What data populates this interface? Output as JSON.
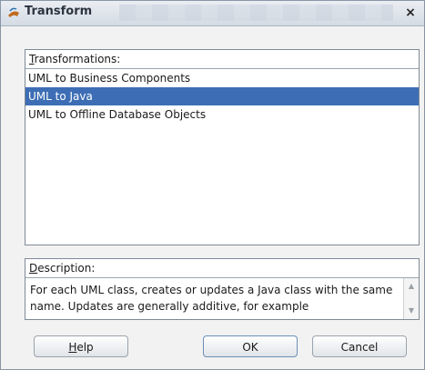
{
  "window": {
    "title": "Transform",
    "close_label": "×"
  },
  "transformations": {
    "label_mnemonic": "T",
    "label_rest": "ransformations:",
    "items": [
      {
        "label": "UML to Business Components",
        "selected": false
      },
      {
        "label": "UML to Java",
        "selected": true
      },
      {
        "label": "UML to Offline Database Objects",
        "selected": false
      }
    ]
  },
  "description": {
    "label_mnemonic": "D",
    "label_rest": "escription:",
    "text": "For each UML class, creates or updates a Java class with the same name. Updates are generally additive, for example"
  },
  "buttons": {
    "help_mnemonic": "H",
    "help_rest": "elp",
    "ok": "OK",
    "cancel": "Cancel"
  },
  "colors": {
    "selection": "#3d6eb5",
    "titlebar": "#d4dbe4"
  }
}
